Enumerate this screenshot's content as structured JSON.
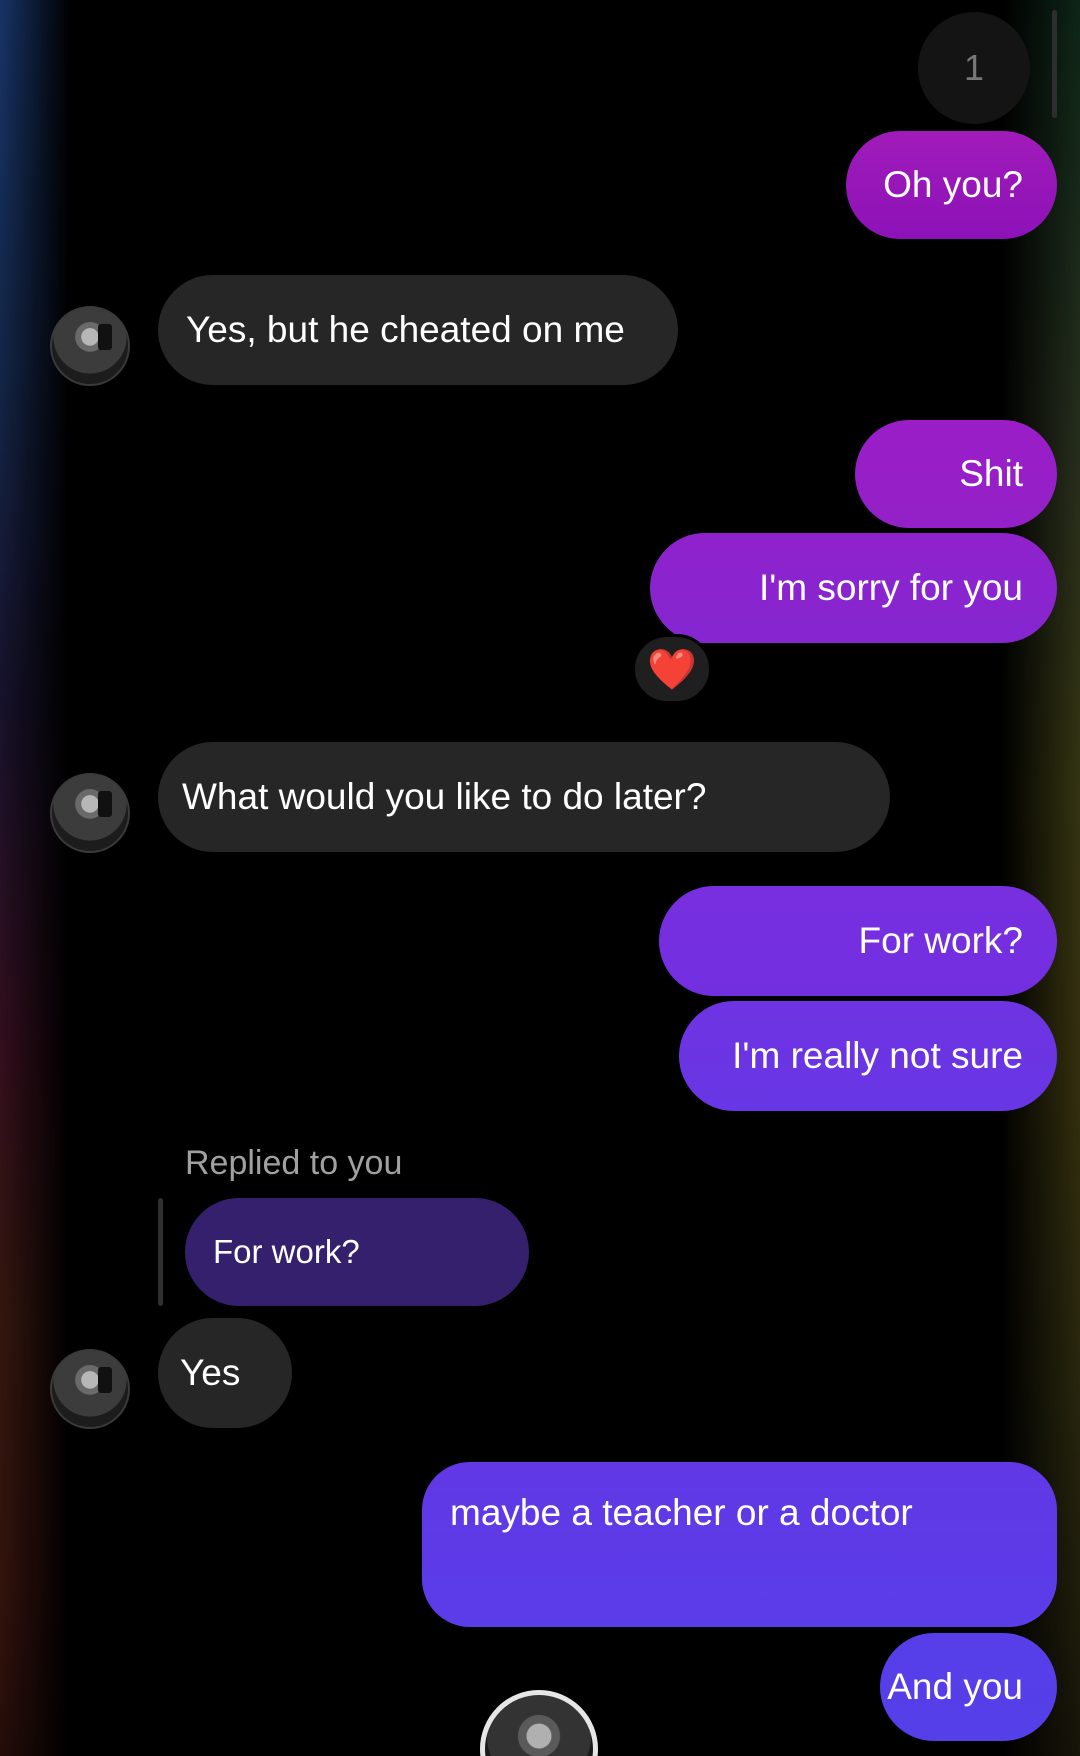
{
  "scroll_counter": "1",
  "messages": [
    {
      "side": "out",
      "text": "Oh you?"
    },
    {
      "side": "in",
      "text": "Yes, but he cheated on me"
    },
    {
      "side": "out",
      "text": "Shit"
    },
    {
      "side": "out",
      "text": "I'm sorry for you",
      "reaction": "❤️"
    },
    {
      "side": "in",
      "text": "What would you like to do later?"
    },
    {
      "side": "out",
      "text": "For work?"
    },
    {
      "side": "out",
      "text": "I'm really not sure"
    },
    {
      "side": "in",
      "text": "Yes",
      "reply": {
        "label": "Replied to you",
        "quoted_text": "For work?"
      }
    },
    {
      "side": "out",
      "text": "maybe a teacher or a doctor"
    },
    {
      "side": "out",
      "text": "And you"
    }
  ],
  "colors": {
    "incoming_bubble": "#262626",
    "outgoing_gradient_top": "#9a18c4",
    "outgoing_gradient_bottom": "#5a3ae6",
    "reply_quote": "#35206e",
    "reaction_heart": "#ff2a4a"
  }
}
